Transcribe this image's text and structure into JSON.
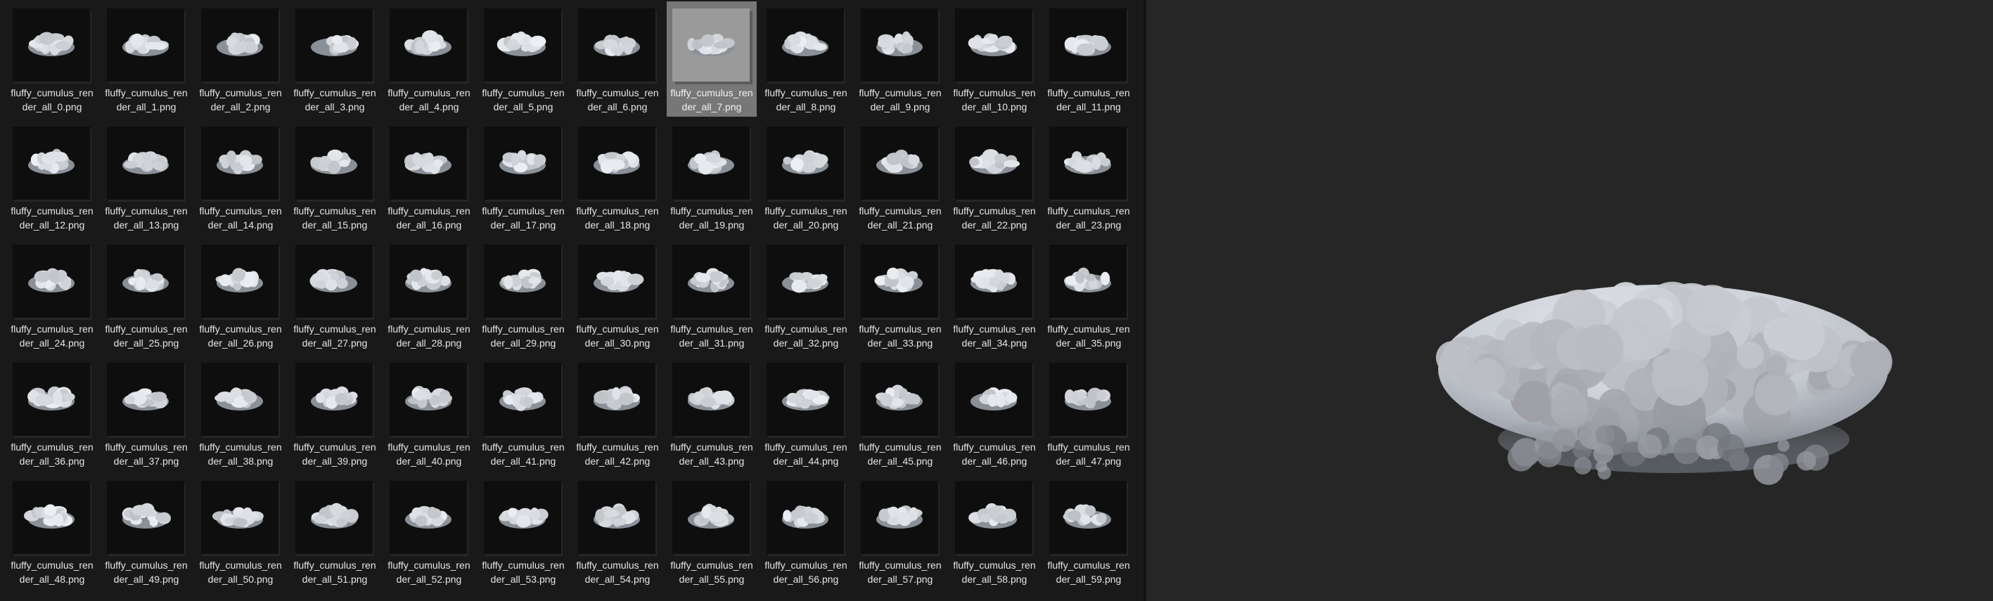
{
  "window": {
    "title": ""
  },
  "grid": {
    "files": [
      {
        "name": "fluffy_cumulus_render_all_0.png"
      },
      {
        "name": "fluffy_cumulus_render_all_1.png"
      },
      {
        "name": "fluffy_cumulus_render_all_2.png"
      },
      {
        "name": "fluffy_cumulus_render_all_3.png"
      },
      {
        "name": "fluffy_cumulus_render_all_4.png"
      },
      {
        "name": "fluffy_cumulus_render_all_5.png"
      },
      {
        "name": "fluffy_cumulus_render_all_6.png"
      },
      {
        "name": "fluffy_cumulus_render_all_7.png",
        "selected": true
      },
      {
        "name": "fluffy_cumulus_render_all_8.png"
      },
      {
        "name": "fluffy_cumulus_render_all_9.png"
      },
      {
        "name": "fluffy_cumulus_render_all_10.png"
      },
      {
        "name": "fluffy_cumulus_render_all_11.png"
      },
      {
        "name": "fluffy_cumulus_render_all_12.png"
      },
      {
        "name": "fluffy_cumulus_render_all_13.png"
      },
      {
        "name": "fluffy_cumulus_render_all_14.png"
      },
      {
        "name": "fluffy_cumulus_render_all_15.png"
      },
      {
        "name": "fluffy_cumulus_render_all_16.png"
      },
      {
        "name": "fluffy_cumulus_render_all_17.png"
      },
      {
        "name": "fluffy_cumulus_render_all_18.png"
      },
      {
        "name": "fluffy_cumulus_render_all_19.png"
      },
      {
        "name": "fluffy_cumulus_render_all_20.png"
      },
      {
        "name": "fluffy_cumulus_render_all_21.png"
      },
      {
        "name": "fluffy_cumulus_render_all_22.png"
      },
      {
        "name": "fluffy_cumulus_render_all_23.png"
      },
      {
        "name": "fluffy_cumulus_render_all_24.png"
      },
      {
        "name": "fluffy_cumulus_render_all_25.png"
      },
      {
        "name": "fluffy_cumulus_render_all_26.png"
      },
      {
        "name": "fluffy_cumulus_render_all_27.png"
      },
      {
        "name": "fluffy_cumulus_render_all_28.png"
      },
      {
        "name": "fluffy_cumulus_render_all_29.png"
      },
      {
        "name": "fluffy_cumulus_render_all_30.png"
      },
      {
        "name": "fluffy_cumulus_render_all_31.png"
      },
      {
        "name": "fluffy_cumulus_render_all_32.png"
      },
      {
        "name": "fluffy_cumulus_render_all_33.png"
      },
      {
        "name": "fluffy_cumulus_render_all_34.png"
      },
      {
        "name": "fluffy_cumulus_render_all_35.png"
      },
      {
        "name": "fluffy_cumulus_render_all_36.png"
      },
      {
        "name": "fluffy_cumulus_render_all_37.png"
      },
      {
        "name": "fluffy_cumulus_render_all_38.png"
      },
      {
        "name": "fluffy_cumulus_render_all_39.png"
      },
      {
        "name": "fluffy_cumulus_render_all_40.png"
      },
      {
        "name": "fluffy_cumulus_render_all_41.png"
      },
      {
        "name": "fluffy_cumulus_render_all_42.png"
      },
      {
        "name": "fluffy_cumulus_render_all_43.png"
      },
      {
        "name": "fluffy_cumulus_render_all_44.png"
      },
      {
        "name": "fluffy_cumulus_render_all_45.png"
      },
      {
        "name": "fluffy_cumulus_render_all_46.png"
      },
      {
        "name": "fluffy_cumulus_render_all_47.png"
      },
      {
        "name": "fluffy_cumulus_render_all_48.png"
      },
      {
        "name": "fluffy_cumulus_render_all_49.png"
      },
      {
        "name": "fluffy_cumulus_render_all_50.png"
      },
      {
        "name": "fluffy_cumulus_render_all_51.png"
      },
      {
        "name": "fluffy_cumulus_render_all_52.png"
      },
      {
        "name": "fluffy_cumulus_render_all_53.png"
      },
      {
        "name": "fluffy_cumulus_render_all_54.png"
      },
      {
        "name": "fluffy_cumulus_render_all_55.png"
      },
      {
        "name": "fluffy_cumulus_render_all_56.png"
      },
      {
        "name": "fluffy_cumulus_render_all_57.png"
      },
      {
        "name": "fluffy_cumulus_render_all_58.png"
      },
      {
        "name": "fluffy_cumulus_render_all_59.png"
      }
    ]
  },
  "preview": {
    "image_icon": "cloud-render-image"
  },
  "colors": {
    "background": "#191919",
    "preview_background": "#262626",
    "selected_item": "#777777",
    "text": "#e6e6e6",
    "cloud_light": "#d9dde2",
    "cloud_shadow": "#7d838b"
  }
}
